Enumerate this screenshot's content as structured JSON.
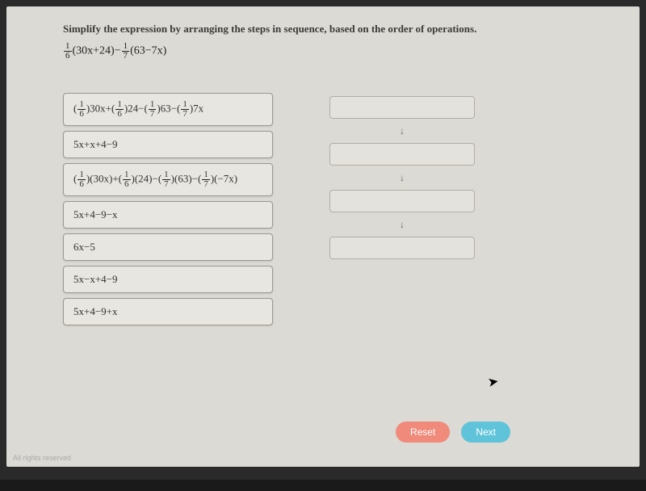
{
  "question": "Simplify the expression by arranging the steps in sequence, based on the order of operations.",
  "expression_parts": {
    "f1n": "1",
    "f1d": "6",
    "mid1": "(30x+24)−",
    "f2n": "1",
    "f2d": "7",
    "mid2": "(63−7x)"
  },
  "tiles": [
    {
      "html": "(<span class='frac'><span class='n'>1</span><span class='d'>6</span></span>)30x+(<span class='frac'><span class='n'>1</span><span class='d'>6</span></span>)24−(<span class='frac'><span class='n'>1</span><span class='d'>7</span></span>)63−(<span class='frac'><span class='n'>1</span><span class='d'>7</span></span>)7x"
    },
    {
      "html": "5x+x+4−9"
    },
    {
      "html": "(<span class='frac'><span class='n'>1</span><span class='d'>6</span></span>)(30x)+(<span class='frac'><span class='n'>1</span><span class='d'>6</span></span>)(24)−(<span class='frac'><span class='n'>1</span><span class='d'>7</span></span>)(63)−(<span class='frac'><span class='n'>1</span><span class='d'>7</span></span>)(−7x)"
    },
    {
      "html": "5x+4−9−x"
    },
    {
      "html": "6x−5"
    },
    {
      "html": "5x−x+4−9"
    },
    {
      "html": "5x+4−9+x"
    }
  ],
  "arrow": "↓",
  "buttons": {
    "reset": "Reset",
    "next": "Next"
  },
  "footer": "All rights reserved"
}
